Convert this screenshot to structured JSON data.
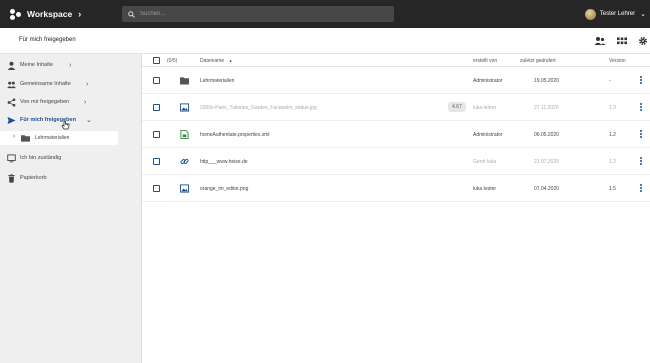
{
  "topbar": {
    "app_title": "Workspace",
    "search_placeholder": "Suchen...",
    "user_name": "Tester Lehrer"
  },
  "header": {
    "title": "Für mich freigegeben"
  },
  "sidebar": {
    "items": [
      {
        "label": "Meine Inhalte"
      },
      {
        "label": "Gemeinsame Inhalte"
      },
      {
        "label": "Von mir freigegeben"
      },
      {
        "label": "Für mich freigegeben"
      },
      {
        "label": "Lehrmaterialien"
      },
      {
        "label": "Ich bin zuständig"
      },
      {
        "label": "Papierkorb"
      }
    ]
  },
  "table": {
    "count_label": "(0/5)",
    "columns": {
      "name": "Dateiname",
      "sort_indicator": "▲",
      "created_by": "erstellt von",
      "modified": "zuletzt geändert",
      "version": "Version"
    },
    "rows": [
      {
        "name": "Lehrmaterialien",
        "badge": "",
        "created_by": "Administrator",
        "modified": "19.05.2020",
        "version": "-",
        "icon": "folder-icon",
        "faded": false
      },
      {
        "name": "2300x-Paris_Tuileries_Garden_Facepalm_statue.jpg",
        "badge": "4.67",
        "created_by": "luka lehrer",
        "modified": "27.11.2020",
        "version": "1.3",
        "icon": "image-icon",
        "faded": true
      },
      {
        "name": "homeAuthentate.properties.xml",
        "badge": "",
        "created_by": "Administrator",
        "modified": "06.05.2020",
        "version": "1.2",
        "icon": "spreadsheet-icon",
        "faded": false
      },
      {
        "name": "http___www.heise.de",
        "badge": "",
        "created_by": "Gerrit luka",
        "modified": "21.07.2020",
        "version": "1.2",
        "icon": "link-icon",
        "faded": true
      },
      {
        "name": "orange_im_editor.png",
        "badge": "",
        "created_by": "luka tester",
        "modified": "07.04.2020",
        "version": "1.5",
        "icon": "image-icon",
        "faded": false
      }
    ]
  },
  "colors": {
    "topbar": "#262626",
    "accent": "#1d4f91",
    "sidebar_bg": "#efefef"
  }
}
